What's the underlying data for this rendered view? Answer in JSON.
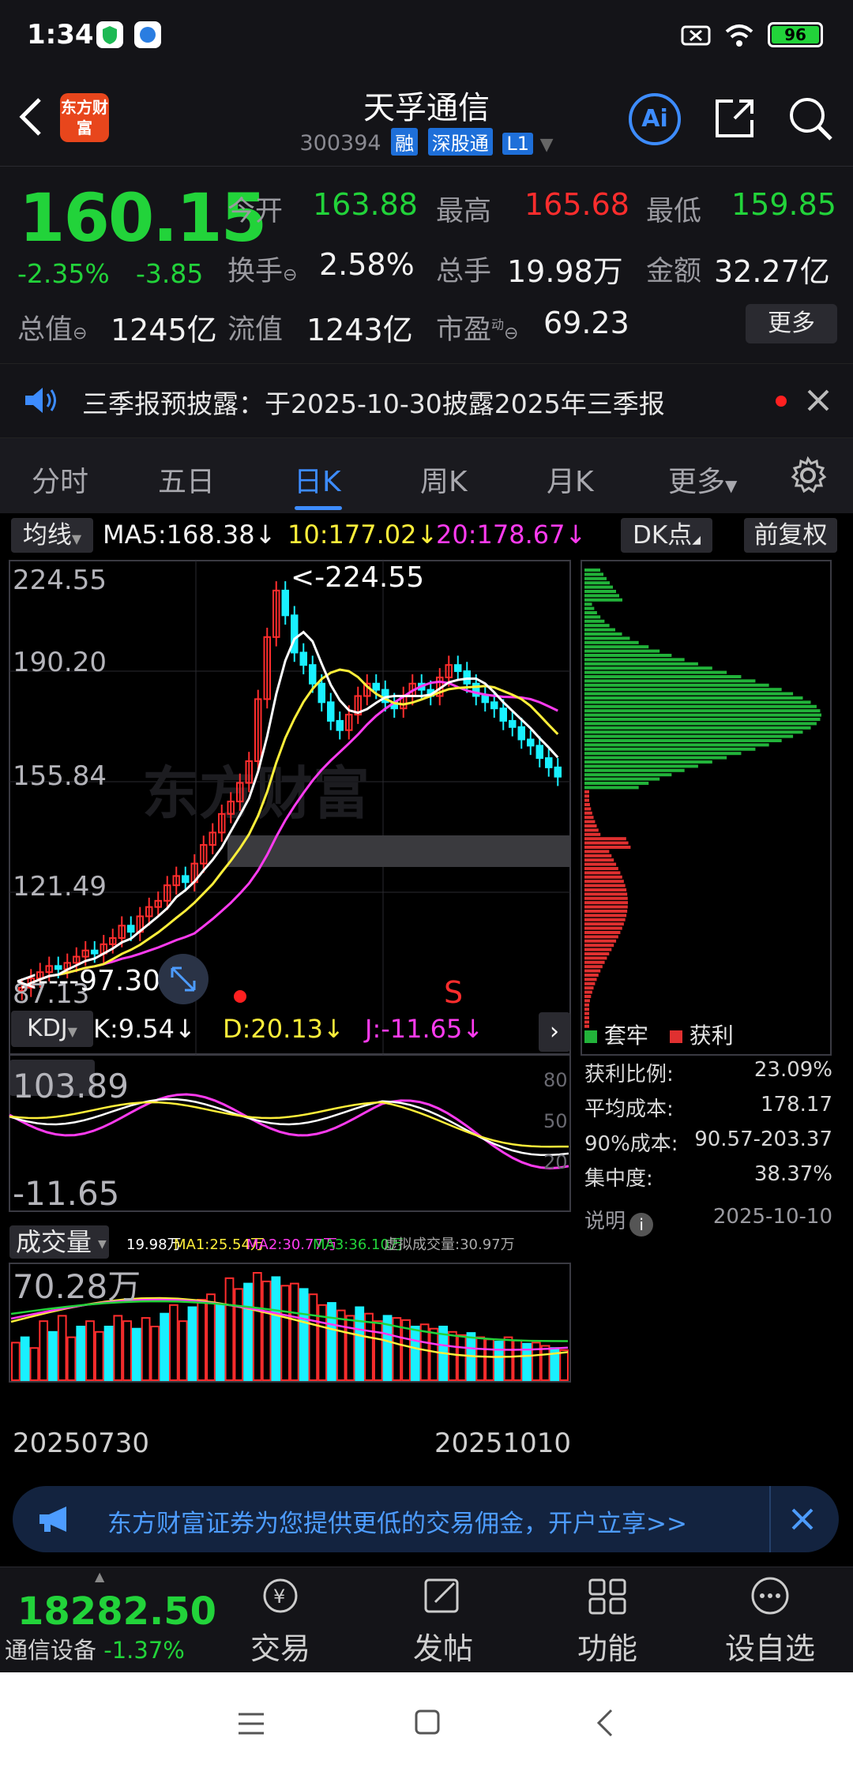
{
  "status_bar": {
    "time": "1:34",
    "battery": "96"
  },
  "header": {
    "logo_text": "东方财富",
    "stock_name": "天孚通信",
    "stock_code": "300394",
    "tags": [
      "融",
      "深股通",
      "L1"
    ],
    "ai_label": "Ai"
  },
  "quote": {
    "price": "160.15",
    "change_pct": "-2.35%",
    "change_amt": "-3.85",
    "open_label": "今开",
    "open": "163.88",
    "high_label": "最高",
    "high": "165.68",
    "low_label": "最低",
    "low": "159.85",
    "turnover_label": "换手",
    "turnover": "2.58%",
    "volume_label": "总手",
    "volume": "19.98万",
    "amount_label": "金额",
    "amount": "32.27亿",
    "mktcap_label": "总值",
    "mktcap": "1245亿",
    "float_label": "流值",
    "float": "1243亿",
    "pe_label": "市盈",
    "pe_sup": "动",
    "pe": "69.23",
    "more_label": "更多"
  },
  "notice": {
    "text": "三季报预披露：于2025-10-30披露2025年三季报"
  },
  "tabs": [
    "分时",
    "五日",
    "日K",
    "周K",
    "月K",
    "更多"
  ],
  "active_tab": 2,
  "kline": {
    "ma_toggle": "均线",
    "ma5": "MA5:168.38",
    "ma10": "10:177.02",
    "ma20": "20:178.67",
    "dk_label": "DK点",
    "adj_label": "前复权",
    "yticks": [
      "224.55",
      "190.20",
      "155.84",
      "121.49",
      "87.13"
    ],
    "high_marker": "<-224.55",
    "low_marker": "<----97.30",
    "sell_marker": "S",
    "watermark": "东方财富",
    "colors": {
      "up": "#ff2d2d",
      "down": "#19f0ff",
      "ma5": "#ffffff",
      "ma10": "#ffef3a",
      "ma20": "#ff3bf0"
    }
  },
  "kdj": {
    "label": "KDJ",
    "k": "K:9.54",
    "d": "D:20.13",
    "j": "J:-11.65",
    "top": "103.89",
    "bottom": "-11.65",
    "levels": [
      "80",
      "50",
      "20"
    ]
  },
  "vol": {
    "label": "成交量",
    "legend_vol": "19.98万",
    "legend_ma1": "MA1:25.54万",
    "legend_ma2": "MA2:30.77万",
    "legend_ma3": "MA3:36.10万",
    "legend_virtual": "虚拟成交量:30.97万",
    "top": "70.28万",
    "date_start": "20250730",
    "date_end": "20251010"
  },
  "chips": {
    "legend_trapped": "套牢",
    "legend_profit": "获利",
    "rows": [
      {
        "label": "获利比例:",
        "value": "23.09%"
      },
      {
        "label": "平均成本:",
        "value": "178.17"
      },
      {
        "label": "90%成本:",
        "value": "90.57-203.37"
      },
      {
        "label": "集中度:",
        "value": "38.37%"
      }
    ],
    "note_label": "说明",
    "date": "2025-10-10"
  },
  "ad": {
    "text": "东方财富证券为您提供更低的交易佣金，开户立享>>"
  },
  "bottom_nav": {
    "index_value": "18282.50",
    "index_name": "通信设备",
    "index_change": "-1.37%",
    "items": [
      "交易",
      "发帖",
      "功能",
      "设自选"
    ]
  }
}
